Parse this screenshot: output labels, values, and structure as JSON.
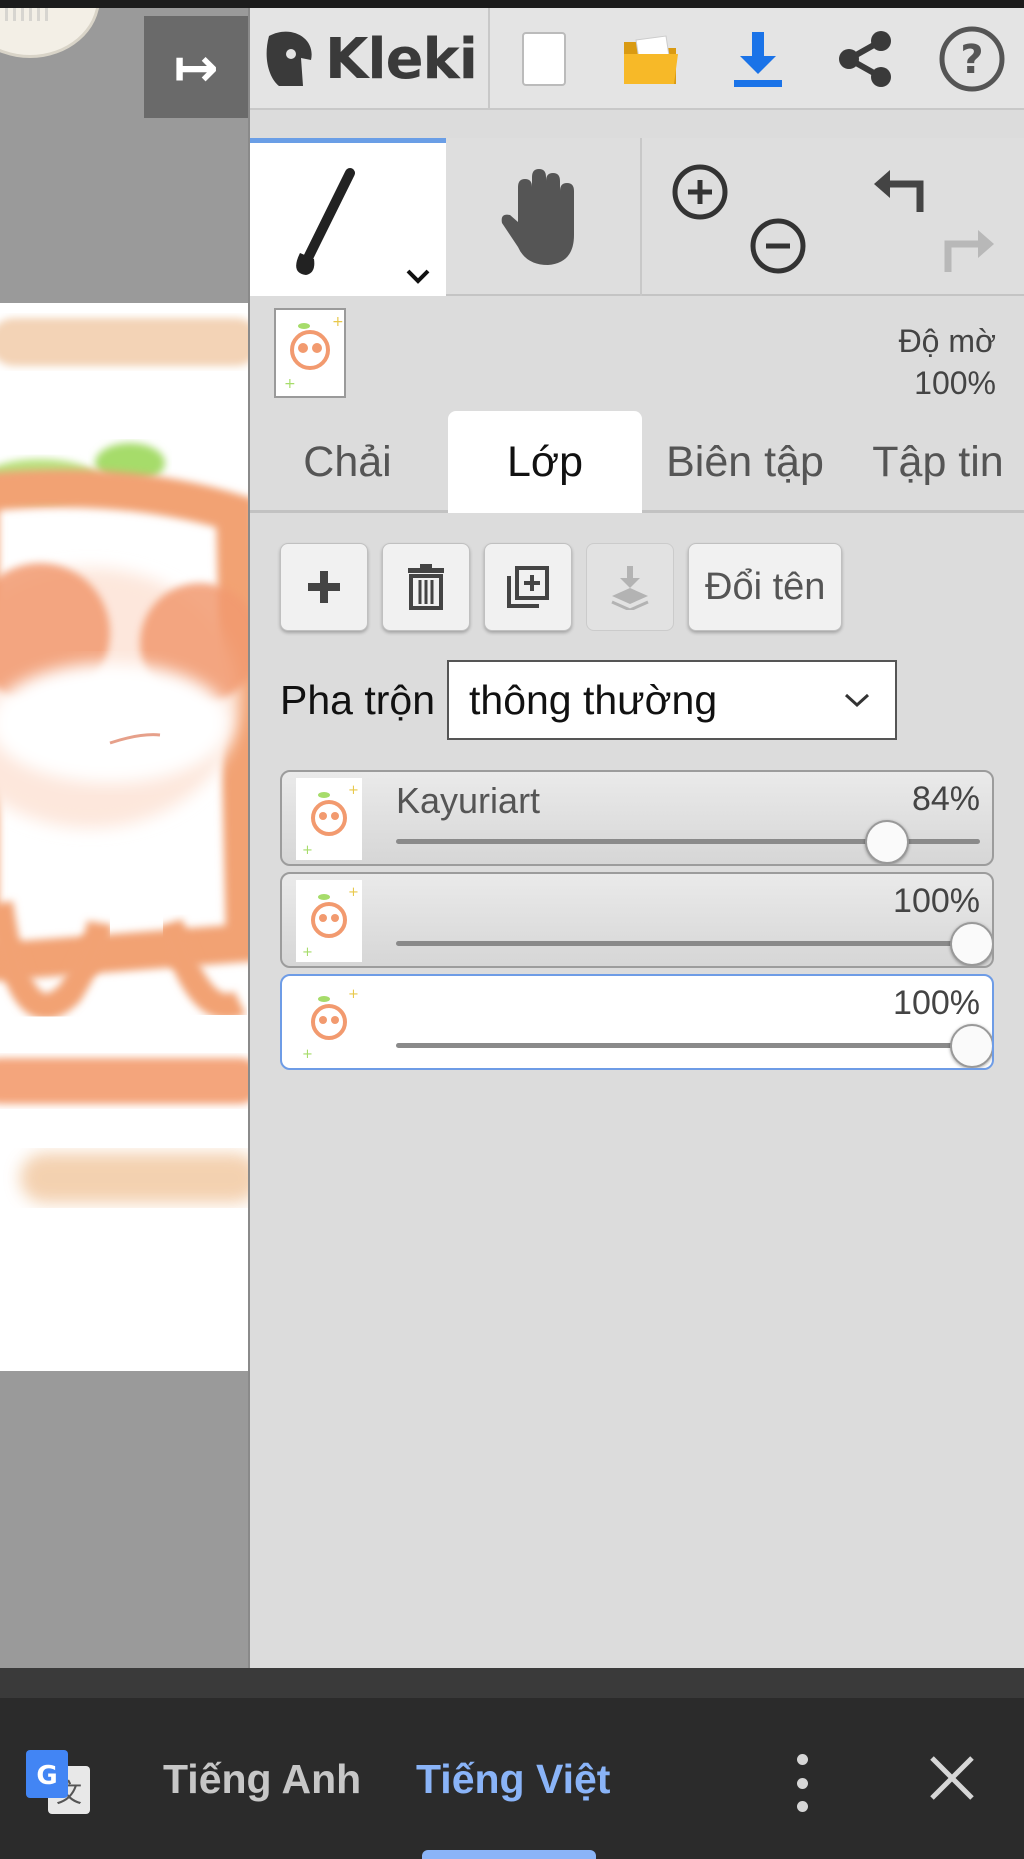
{
  "app": {
    "name": "Kleki"
  },
  "toolbar": {
    "items": [
      "new-file-icon",
      "open-folder-icon",
      "download-icon",
      "share-icon",
      "help-icon"
    ],
    "accent": "#1a73e8"
  },
  "tools": {
    "active": "brush"
  },
  "preview": {
    "opacity_label": "Độ mờ",
    "opacity_value": "100%"
  },
  "tabs": [
    {
      "label": "Chải",
      "active": false
    },
    {
      "label": "Lớp",
      "active": true
    },
    {
      "label": "Biên tập",
      "active": false
    },
    {
      "label": "Tập tin",
      "active": false
    }
  ],
  "layer_actions": {
    "rename_label": "Đổi tên"
  },
  "blend": {
    "label": "Pha trộn",
    "value": "thông thường"
  },
  "layers": [
    {
      "name": "Kayuriart",
      "opacity": "84%",
      "opacity_fraction": 0.84,
      "selected": false
    },
    {
      "name": "",
      "opacity": "100%",
      "opacity_fraction": 1.0,
      "selected": false
    },
    {
      "name": "",
      "opacity": "100%",
      "opacity_fraction": 1.0,
      "selected": true
    }
  ],
  "translate_bar": {
    "source_lang": "Tiếng Anh",
    "target_lang": "Tiếng Việt",
    "active_color": "#8ab4f8"
  }
}
